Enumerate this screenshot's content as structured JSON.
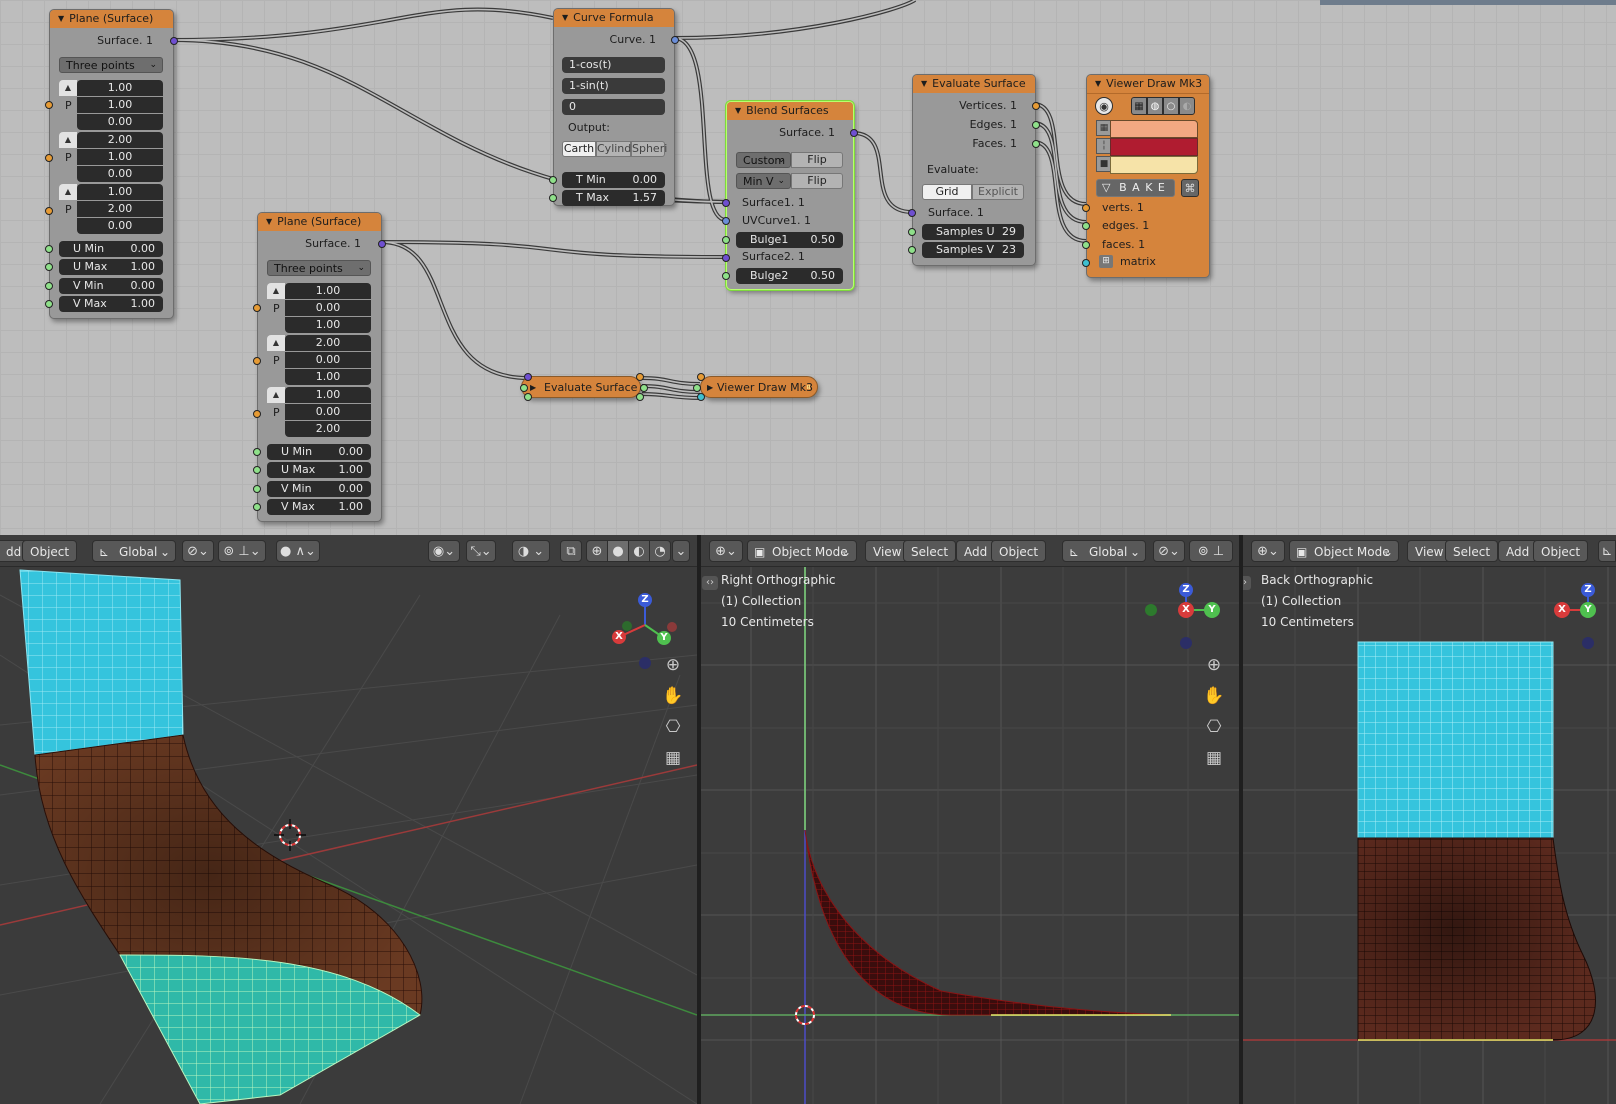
{
  "nodes": {
    "plane1": {
      "title": "Plane (Surface)",
      "output": "Surface. 1",
      "mode": "Three points",
      "p_label": "P",
      "points": [
        [
          "1.00",
          "1.00",
          "0.00"
        ],
        [
          "2.00",
          "1.00",
          "0.00"
        ],
        [
          "1.00",
          "2.00",
          "0.00"
        ]
      ],
      "ranges": [
        {
          "label": "U Min",
          "value": "0.00"
        },
        {
          "label": "U Max",
          "value": "1.00"
        },
        {
          "label": "V Min",
          "value": "0.00"
        },
        {
          "label": "V Max",
          "value": "1.00"
        }
      ]
    },
    "plane2": {
      "title": "Plane (Surface)",
      "output": "Surface. 1",
      "mode": "Three points",
      "p_label": "P",
      "points": [
        [
          "1.00",
          "0.00",
          "1.00"
        ],
        [
          "2.00",
          "0.00",
          "1.00"
        ],
        [
          "1.00",
          "0.00",
          "2.00"
        ]
      ],
      "ranges": [
        {
          "label": "U Min",
          "value": "0.00"
        },
        {
          "label": "U Max",
          "value": "1.00"
        },
        {
          "label": "V Min",
          "value": "0.00"
        },
        {
          "label": "V Max",
          "value": "1.00"
        }
      ]
    },
    "curve_formula": {
      "title": "Curve Formula",
      "output": "Curve. 1",
      "formulas": [
        "1-cos(t)",
        "1-sin(t)",
        "0"
      ],
      "output_label": "Output:",
      "coord_modes": [
        "Carth",
        "Cylindr",
        "Spheri"
      ],
      "tmin": {
        "label": "T Min",
        "value": "0.00"
      },
      "tmax": {
        "label": "T Max",
        "value": "1.57"
      }
    },
    "blend": {
      "title": "Blend Surfaces",
      "output": "Surface. 1",
      "mode1": "Custom",
      "flip": "Flip",
      "mode2": "Min V",
      "inputs": [
        "Surface1. 1",
        "UVCurve1. 1",
        "Surface2. 1"
      ],
      "bulge1": {
        "label": "Bulge1",
        "value": "0.50"
      },
      "bulge2": {
        "label": "Bulge2",
        "value": "0.50"
      }
    },
    "evaluate": {
      "title": "Evaluate Surface",
      "outputs": [
        "Vertices. 1",
        "Edges. 1",
        "Faces. 1"
      ],
      "evaluate_label": "Evaluate:",
      "modes": [
        "Grid",
        "Explicit"
      ],
      "input": "Surface. 1",
      "samples_u": {
        "label": "Samples U",
        "value": "29"
      },
      "samples_v": {
        "label": "Samples V",
        "value": "23"
      }
    },
    "viewer": {
      "title": "Viewer Draw Mk3",
      "bake": "B A K E",
      "inputs": [
        "verts. 1",
        "edges. 1",
        "faces. 1",
        "matrix"
      ],
      "colors": [
        "#f3a882",
        "#b01c30",
        "#f6e3a8"
      ]
    },
    "eval_collapsed": {
      "title": "Evaluate Surface"
    },
    "viewer_collapsed": {
      "title": "Viewer Draw Mk3"
    }
  },
  "viewport_left": {
    "header": [
      "dd",
      "Object",
      "Global"
    ]
  },
  "viewport_mid": {
    "header": {
      "mode": "Object Mode",
      "view": "View",
      "select": "Select",
      "add": "Add",
      "object": "Object",
      "orient": "Global"
    },
    "overlay": [
      "Right Orthographic",
      "(1) Collection",
      "10 Centimeters"
    ]
  },
  "viewport_right": {
    "header": {
      "mode": "Object Mode",
      "view": "View",
      "select": "Select",
      "add": "Add",
      "object": "Object"
    },
    "overlay": [
      "Back Orthographic",
      "(1) Collection",
      "10 Centimeters"
    ]
  },
  "gizmo": {
    "x": "X",
    "y": "Y",
    "z": "Z"
  },
  "colors": {
    "node_header": "#d5843c",
    "node_body": "#999999",
    "surface_cyan": "#33c4df",
    "surface_brown": "#6b3a22",
    "background": "#bdbdbd"
  }
}
